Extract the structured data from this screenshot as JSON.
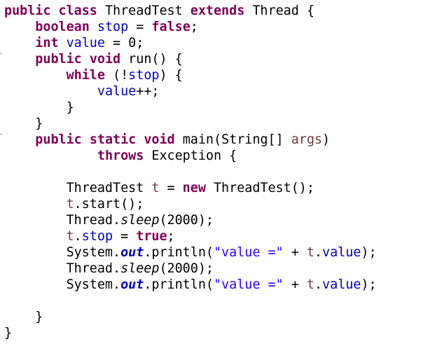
{
  "editor": {
    "lines": [
      [
        {
          "t": "kw",
          "v": "public"
        },
        {
          "t": "pl",
          "v": " "
        },
        {
          "t": "kw",
          "v": "class"
        },
        {
          "t": "pl",
          "v": " ThreadTest "
        },
        {
          "t": "kw",
          "v": "extends"
        },
        {
          "t": "pl",
          "v": " Thread {"
        }
      ],
      [
        {
          "t": "pl",
          "v": "    "
        },
        {
          "t": "kw",
          "v": "boolean"
        },
        {
          "t": "pl",
          "v": " "
        },
        {
          "t": "fld",
          "v": "stop"
        },
        {
          "t": "pl",
          "v": " = "
        },
        {
          "t": "kw",
          "v": "false"
        },
        {
          "t": "pl",
          "v": ";"
        }
      ],
      [
        {
          "t": "pl",
          "v": "    "
        },
        {
          "t": "kw",
          "v": "int"
        },
        {
          "t": "pl",
          "v": " "
        },
        {
          "t": "fld",
          "v": "value"
        },
        {
          "t": "pl",
          "v": " = 0;"
        }
      ],
      [
        {
          "t": "pl",
          "v": "    "
        },
        {
          "t": "kw",
          "v": "public"
        },
        {
          "t": "pl",
          "v": " "
        },
        {
          "t": "kw",
          "v": "void"
        },
        {
          "t": "pl",
          "v": " run() {"
        }
      ],
      [
        {
          "t": "pl",
          "v": "        "
        },
        {
          "t": "kw",
          "v": "while"
        },
        {
          "t": "pl",
          "v": " (!"
        },
        {
          "t": "fld",
          "v": "stop"
        },
        {
          "t": "pl",
          "v": ") {"
        }
      ],
      [
        {
          "t": "pl",
          "v": "            "
        },
        {
          "t": "fld",
          "v": "value"
        },
        {
          "t": "pl",
          "v": "++;"
        }
      ],
      [
        {
          "t": "pl",
          "v": "        }"
        }
      ],
      [
        {
          "t": "pl",
          "v": "    }"
        }
      ],
      [
        {
          "t": "pl",
          "v": "    "
        },
        {
          "t": "kw",
          "v": "public"
        },
        {
          "t": "pl",
          "v": " "
        },
        {
          "t": "kw",
          "v": "static"
        },
        {
          "t": "pl",
          "v": " "
        },
        {
          "t": "kw",
          "v": "void"
        },
        {
          "t": "pl",
          "v": " main(String[] "
        },
        {
          "t": "param",
          "v": "args"
        },
        {
          "t": "pl",
          "v": ")"
        }
      ],
      [
        {
          "t": "pl",
          "v": "            "
        },
        {
          "t": "kw",
          "v": "throws"
        },
        {
          "t": "pl",
          "v": " Exception {"
        }
      ],
      [
        {
          "t": "pl",
          "v": ""
        }
      ],
      [
        {
          "t": "pl",
          "v": "        ThreadTest "
        },
        {
          "t": "param",
          "v": "t"
        },
        {
          "t": "pl",
          "v": " = "
        },
        {
          "t": "kw",
          "v": "new"
        },
        {
          "t": "pl",
          "v": " ThreadTest();"
        }
      ],
      [
        {
          "t": "pl",
          "v": "        "
        },
        {
          "t": "param",
          "v": "t"
        },
        {
          "t": "pl",
          "v": ".start();"
        }
      ],
      [
        {
          "t": "pl",
          "v": "        Thread."
        },
        {
          "t": "smeth",
          "v": "sleep"
        },
        {
          "t": "pl",
          "v": "(2000);"
        }
      ],
      [
        {
          "t": "pl",
          "v": "        "
        },
        {
          "t": "param",
          "v": "t"
        },
        {
          "t": "pl",
          "v": "."
        },
        {
          "t": "fld",
          "v": "stop"
        },
        {
          "t": "pl",
          "v": " = "
        },
        {
          "t": "kw",
          "v": "true"
        },
        {
          "t": "pl",
          "v": ";"
        }
      ],
      [
        {
          "t": "pl",
          "v": "        System."
        },
        {
          "t": "sfld",
          "v": "out"
        },
        {
          "t": "pl",
          "v": ".println("
        },
        {
          "t": "str",
          "v": "\"value =\""
        },
        {
          "t": "pl",
          "v": " + "
        },
        {
          "t": "param",
          "v": "t"
        },
        {
          "t": "pl",
          "v": "."
        },
        {
          "t": "fld",
          "v": "value"
        },
        {
          "t": "pl",
          "v": ");"
        }
      ],
      [
        {
          "t": "pl",
          "v": "        Thread."
        },
        {
          "t": "smeth",
          "v": "sleep"
        },
        {
          "t": "pl",
          "v": "(2000);"
        }
      ],
      [
        {
          "t": "pl",
          "v": "        System."
        },
        {
          "t": "sfld",
          "v": "out"
        },
        {
          "t": "pl",
          "v": ".println("
        },
        {
          "t": "str",
          "v": "\"value =\""
        },
        {
          "t": "pl",
          "v": " + "
        },
        {
          "t": "param",
          "v": "t"
        },
        {
          "t": "pl",
          "v": "."
        },
        {
          "t": "fld",
          "v": "value"
        },
        {
          "t": "pl",
          "v": ");"
        }
      ],
      [
        {
          "t": "pl",
          "v": ""
        }
      ],
      [
        {
          "t": "pl",
          "v": "    }"
        }
      ],
      [
        {
          "t": "pl",
          "v": "}"
        }
      ]
    ],
    "fold_marker_lines": [
      3,
      8
    ],
    "colors": {
      "keyword": "#7f0055",
      "field": "#0000c0",
      "string": "#2a00ff",
      "local_variable": "#6a3e3e",
      "plain": "#000000",
      "background": "#ffffff"
    }
  }
}
